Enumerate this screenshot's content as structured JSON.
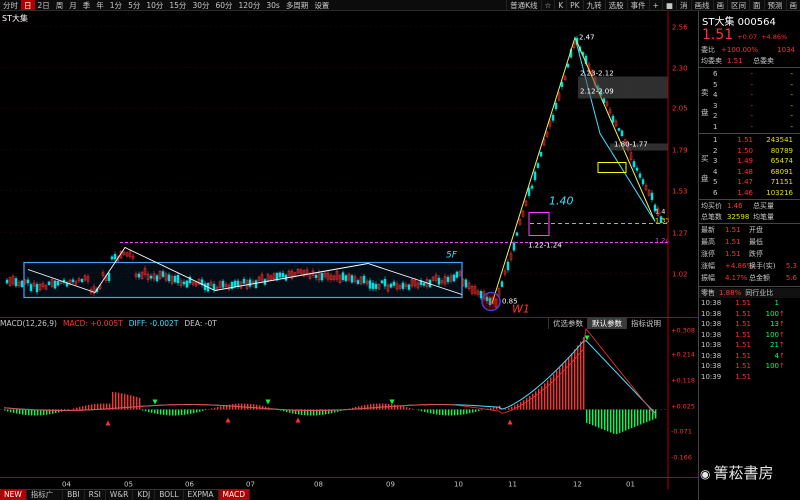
{
  "toolbar": {
    "left_items": [
      "分时",
      "日",
      "2日",
      "周",
      "月",
      "季",
      "年",
      "1分",
      "5分",
      "10分",
      "15分",
      "30分",
      "60分",
      "120分",
      "30s",
      "多周期",
      "设置"
    ],
    "active_index": 1,
    "right_items": [
      "普通K线",
      "☆",
      "K",
      "PK",
      "九转",
      "选股",
      "事件",
      "+",
      "■",
      "消",
      "画线",
      "画",
      "区间",
      "面",
      "预测",
      "画"
    ]
  },
  "chart": {
    "symbol": "ST大集",
    "price_axis": [
      "2.56",
      "2.30",
      "2.05",
      "1.79",
      "1.53",
      "1.27",
      "1.02"
    ],
    "price_tags": [
      {
        "label": "1.4",
        "color": "#ffffff"
      },
      {
        "label": "1.33",
        "color": "#ffff00"
      },
      {
        "label": "1.24",
        "color": "#ff40ff"
      }
    ],
    "annotations": {
      "high": "2.47",
      "fib1": "2.23-2.12",
      "fib2": "2.12-2.09",
      "fib3": "1.80-1.77",
      "zone": "1.22-1.24",
      "low": "0.85",
      "wave_label": "1.40",
      "box_label": "5F",
      "w1_label": "W1"
    },
    "x_axis": [
      "04",
      "05",
      "06",
      "07",
      "08",
      "09",
      "10",
      "11",
      "12",
      "01"
    ],
    "macd_axis": [
      "+0.308",
      "+0.214",
      "+0.118",
      "+0.025",
      "-0.071",
      "-0.166"
    ]
  },
  "macd_header": {
    "title": "MACD(12,26,9)",
    "macd": "MACD: +0.005T",
    "diff": "DIFF: -0.002T",
    "dea": "DEA: -0T"
  },
  "macd_tabs": [
    "优选参数",
    "默认参数",
    "指标说明"
  ],
  "bottom_tabs": [
    "NEW",
    "指标广场",
    "BBI",
    "RSI",
    "W&R",
    "KDJ",
    "BOLL",
    "EXPMA",
    "MACD"
  ],
  "panel": {
    "title": "ST大集 000564",
    "price": "1.51",
    "change": "+0.07",
    "change_pct": "+4.86%",
    "wei_bi_label": "委比",
    "wei_bi": "+100.00%",
    "wei_cha": "1034",
    "jun_pan_label": "均委卖",
    "jun_pan_value": "1.51",
    "zong_mai_label": "总委卖",
    "sell_label": "卖盘",
    "sell": [
      {
        "n": "6",
        "p": "-",
        "v": "-"
      },
      {
        "n": "5",
        "p": "-",
        "v": "-"
      },
      {
        "n": "4",
        "p": "-",
        "v": "-"
      },
      {
        "n": "3",
        "p": "-",
        "v": "-"
      },
      {
        "n": "2",
        "p": "-",
        "v": "-"
      },
      {
        "n": "1",
        "p": "-",
        "v": "-"
      }
    ],
    "buy_label": "买盘",
    "buy": [
      {
        "n": "1",
        "p": "1.51",
        "v": "243541"
      },
      {
        "n": "2",
        "p": "1.50",
        "v": "80789"
      },
      {
        "n": "3",
        "p": "1.49",
        "v": "65474"
      },
      {
        "n": "4",
        "p": "1.48",
        "v": "68091"
      },
      {
        "n": "5",
        "p": "1.47",
        "v": "71151"
      },
      {
        "n": "6",
        "p": "1.46",
        "v": "103216"
      }
    ],
    "jun_buy_label": "均买价",
    "jun_buy_value": "1.46",
    "zong_buy_label": "总买量",
    "zong_buy_value": "",
    "total_label": "总笔数",
    "total_value": "32598",
    "jun_liang_label": "均笔量",
    "stats": [
      {
        "k": "最新",
        "v": "1.51",
        "k2": "开盘",
        "v2": ""
      },
      {
        "k": "最高",
        "v": "1.51",
        "k2": "最低",
        "v2": ""
      },
      {
        "k": "涨停",
        "v": "1.51",
        "k2": "跌停",
        "v2": ""
      },
      {
        "k": "涨幅",
        "v": "+4.86%",
        "k2": "换手(实)",
        "v2": "5.3"
      },
      {
        "k": "振幅",
        "v": "4.17%",
        "k2": "总金额",
        "v2": "5.6"
      }
    ],
    "trade_tabs": [
      "零售",
      "1.88%",
      "同行业比"
    ],
    "trades": [
      {
        "t": "10:38",
        "p": "1.51",
        "v": "1",
        "d": ""
      },
      {
        "t": "10:38",
        "p": "1.51",
        "v": "100",
        "d": "↑"
      },
      {
        "t": "10:38",
        "p": "1.51",
        "v": "13",
        "d": "↑"
      },
      {
        "t": "10:38",
        "p": "1.51",
        "v": "100",
        "d": "↑"
      },
      {
        "t": "10:38",
        "p": "1.51",
        "v": "21",
        "d": "↑"
      },
      {
        "t": "10:38",
        "p": "1.51",
        "v": "4",
        "d": "↑"
      },
      {
        "t": "10:38",
        "p": "1.51",
        "v": "100",
        "d": "↑"
      },
      {
        "t": "10:39",
        "p": "1.51",
        "v": "",
        "d": ""
      }
    ],
    "watermark": "箐菘書房"
  }
}
